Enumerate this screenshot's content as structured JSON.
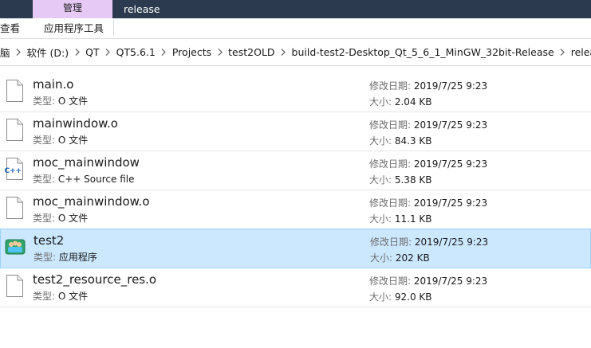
{
  "window": {
    "context_tab": "管理",
    "title": "release"
  },
  "ribbon": {
    "tabs": [
      "查看",
      "应用程序工具"
    ]
  },
  "address": {
    "crumbs": [
      "脑",
      "软件 (D:)",
      "QT",
      "QT5.6.1",
      "Projects",
      "test2OLD",
      "build-test2-Desktop_Qt_5_6_1_MinGW_32bit-Release",
      "release"
    ]
  },
  "labels": {
    "type": "类型: ",
    "date": "修改日期: ",
    "size": "大小: "
  },
  "files": [
    {
      "name": "main.o",
      "type": "O 文件",
      "date": "2019/7/25 9:23",
      "size": "2.04 KB",
      "icon": "blank-file-icon"
    },
    {
      "name": "mainwindow.o",
      "type": "O 文件",
      "date": "2019/7/25 9:23",
      "size": "84.3 KB",
      "icon": "blank-file-icon"
    },
    {
      "name": "moc_mainwindow",
      "type": "C++ Source file",
      "date": "2019/7/25 9:23",
      "size": "5.38 KB",
      "icon": "cpp-file-icon"
    },
    {
      "name": "moc_mainwindow.o",
      "type": "O 文件",
      "date": "2019/7/25 9:23",
      "size": "11.1 KB",
      "icon": "blank-file-icon"
    },
    {
      "name": "test2",
      "type": "应用程序",
      "date": "2019/7/25 9:23",
      "size": "202 KB",
      "icon": "application-icon",
      "selected": true
    },
    {
      "name": "test2_resource_res.o",
      "type": "O 文件",
      "date": "2019/7/25 9:23",
      "size": "92.0 KB",
      "icon": "blank-file-icon"
    }
  ],
  "colors": {
    "titlebar": "#2b3a4f",
    "context_tab": "#e7c9f5",
    "selection": "#cce8ff",
    "selection_border": "#99d1ff"
  }
}
